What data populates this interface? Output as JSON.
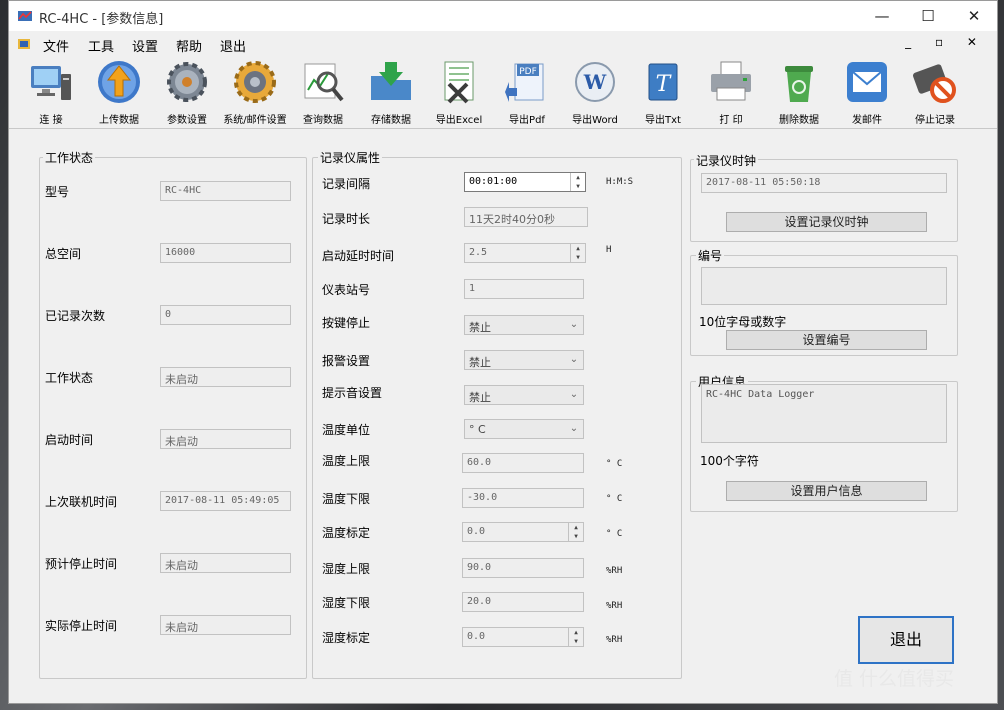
{
  "window": {
    "title": "RC-4HC - [参数信息]"
  },
  "menu": {
    "items": [
      "文件",
      "工具",
      "设置",
      "帮助",
      "退出"
    ]
  },
  "toolbar": {
    "buttons": [
      {
        "label": "连  接",
        "icon": "computer-connect-icon"
      },
      {
        "label": "上传数据",
        "icon": "upload-arrow-icon"
      },
      {
        "label": "参数设置",
        "icon": "gear-icon"
      },
      {
        "label": "系统/邮件设置",
        "icon": "system-gear-icon"
      },
      {
        "label": "查询数据",
        "icon": "magnifier-icon"
      },
      {
        "label": "存储数据",
        "icon": "save-folder-icon"
      },
      {
        "label": "导出Excel",
        "icon": "excel-icon"
      },
      {
        "label": "导出Pdf",
        "icon": "pdf-icon"
      },
      {
        "label": "导出Word",
        "icon": "word-icon"
      },
      {
        "label": "导出Txt",
        "icon": "txt-icon"
      },
      {
        "label": "打  印",
        "icon": "printer-icon"
      },
      {
        "label": "删除数据",
        "icon": "trash-icon"
      },
      {
        "label": "发邮件",
        "icon": "mail-icon"
      },
      {
        "label": "停止记录",
        "icon": "stop-record-icon"
      }
    ]
  },
  "work_status": {
    "title": "工作状态",
    "fields": [
      {
        "label": "型号",
        "value": "RC-4HC"
      },
      {
        "label": "总空间",
        "value": "16000"
      },
      {
        "label": "已记录次数",
        "value": "0"
      },
      {
        "label": "工作状态",
        "value": "未启动"
      },
      {
        "label": "启动时间",
        "value": "未启动"
      },
      {
        "label": "上次联机时间",
        "value": "2017-08-11 05:49:05"
      },
      {
        "label": "预计停止时间",
        "value": "未启动"
      },
      {
        "label": "实际停止时间",
        "value": "未启动"
      }
    ]
  },
  "recorder": {
    "title": "记录仪属性",
    "interval": {
      "label": "记录间隔",
      "value": "00:01:00",
      "unit": "H:M:S"
    },
    "duration": {
      "label": "记录时长",
      "value": "11天2时40分0秒"
    },
    "delay": {
      "label": "启动延时时间",
      "value": "2.5",
      "unit": "H"
    },
    "station": {
      "label": "仪表站号",
      "value": "1"
    },
    "key_stop": {
      "label": "按键停止",
      "value": "禁止"
    },
    "alarm": {
      "label": "报警设置",
      "value": "禁止"
    },
    "beep": {
      "label": "提示音设置",
      "value": "禁止"
    },
    "temp_unit": {
      "label": "温度单位",
      "value": "° C"
    },
    "temp_high": {
      "label": "温度上限",
      "value": "60.0",
      "unit": "° C"
    },
    "temp_low": {
      "label": "温度下限",
      "value": "-30.0",
      "unit": "° C"
    },
    "temp_cal": {
      "label": "温度标定",
      "value": "0.0",
      "unit": "° C"
    },
    "hum_high": {
      "label": "湿度上限",
      "value": "90.0",
      "unit": "%RH"
    },
    "hum_low": {
      "label": "湿度下限",
      "value": "20.0",
      "unit": "%RH"
    },
    "hum_cal": {
      "label": "湿度标定",
      "value": "0.0",
      "unit": "%RH"
    }
  },
  "clock": {
    "title": "记录仪时钟",
    "value": "2017-08-11 05:50:18",
    "button": "设置记录仪时钟"
  },
  "serial": {
    "title": "编号",
    "value": "",
    "hint": "10位字母或数字",
    "button": "设置编号"
  },
  "user_info": {
    "title": "用户信息",
    "value": "RC-4HC Data Logger",
    "hint": "100个字符",
    "button": "设置用户信息"
  },
  "exit_button": "退出",
  "watermark": "值 什么值得买",
  "spin_glyphs": {
    "up": "▲",
    "down": "▼"
  },
  "combo_glyph": "⌄",
  "window_buttons": {
    "min": "—",
    "max": "☐",
    "close": "✕"
  },
  "mdi_buttons": "_ ▫ ✕"
}
